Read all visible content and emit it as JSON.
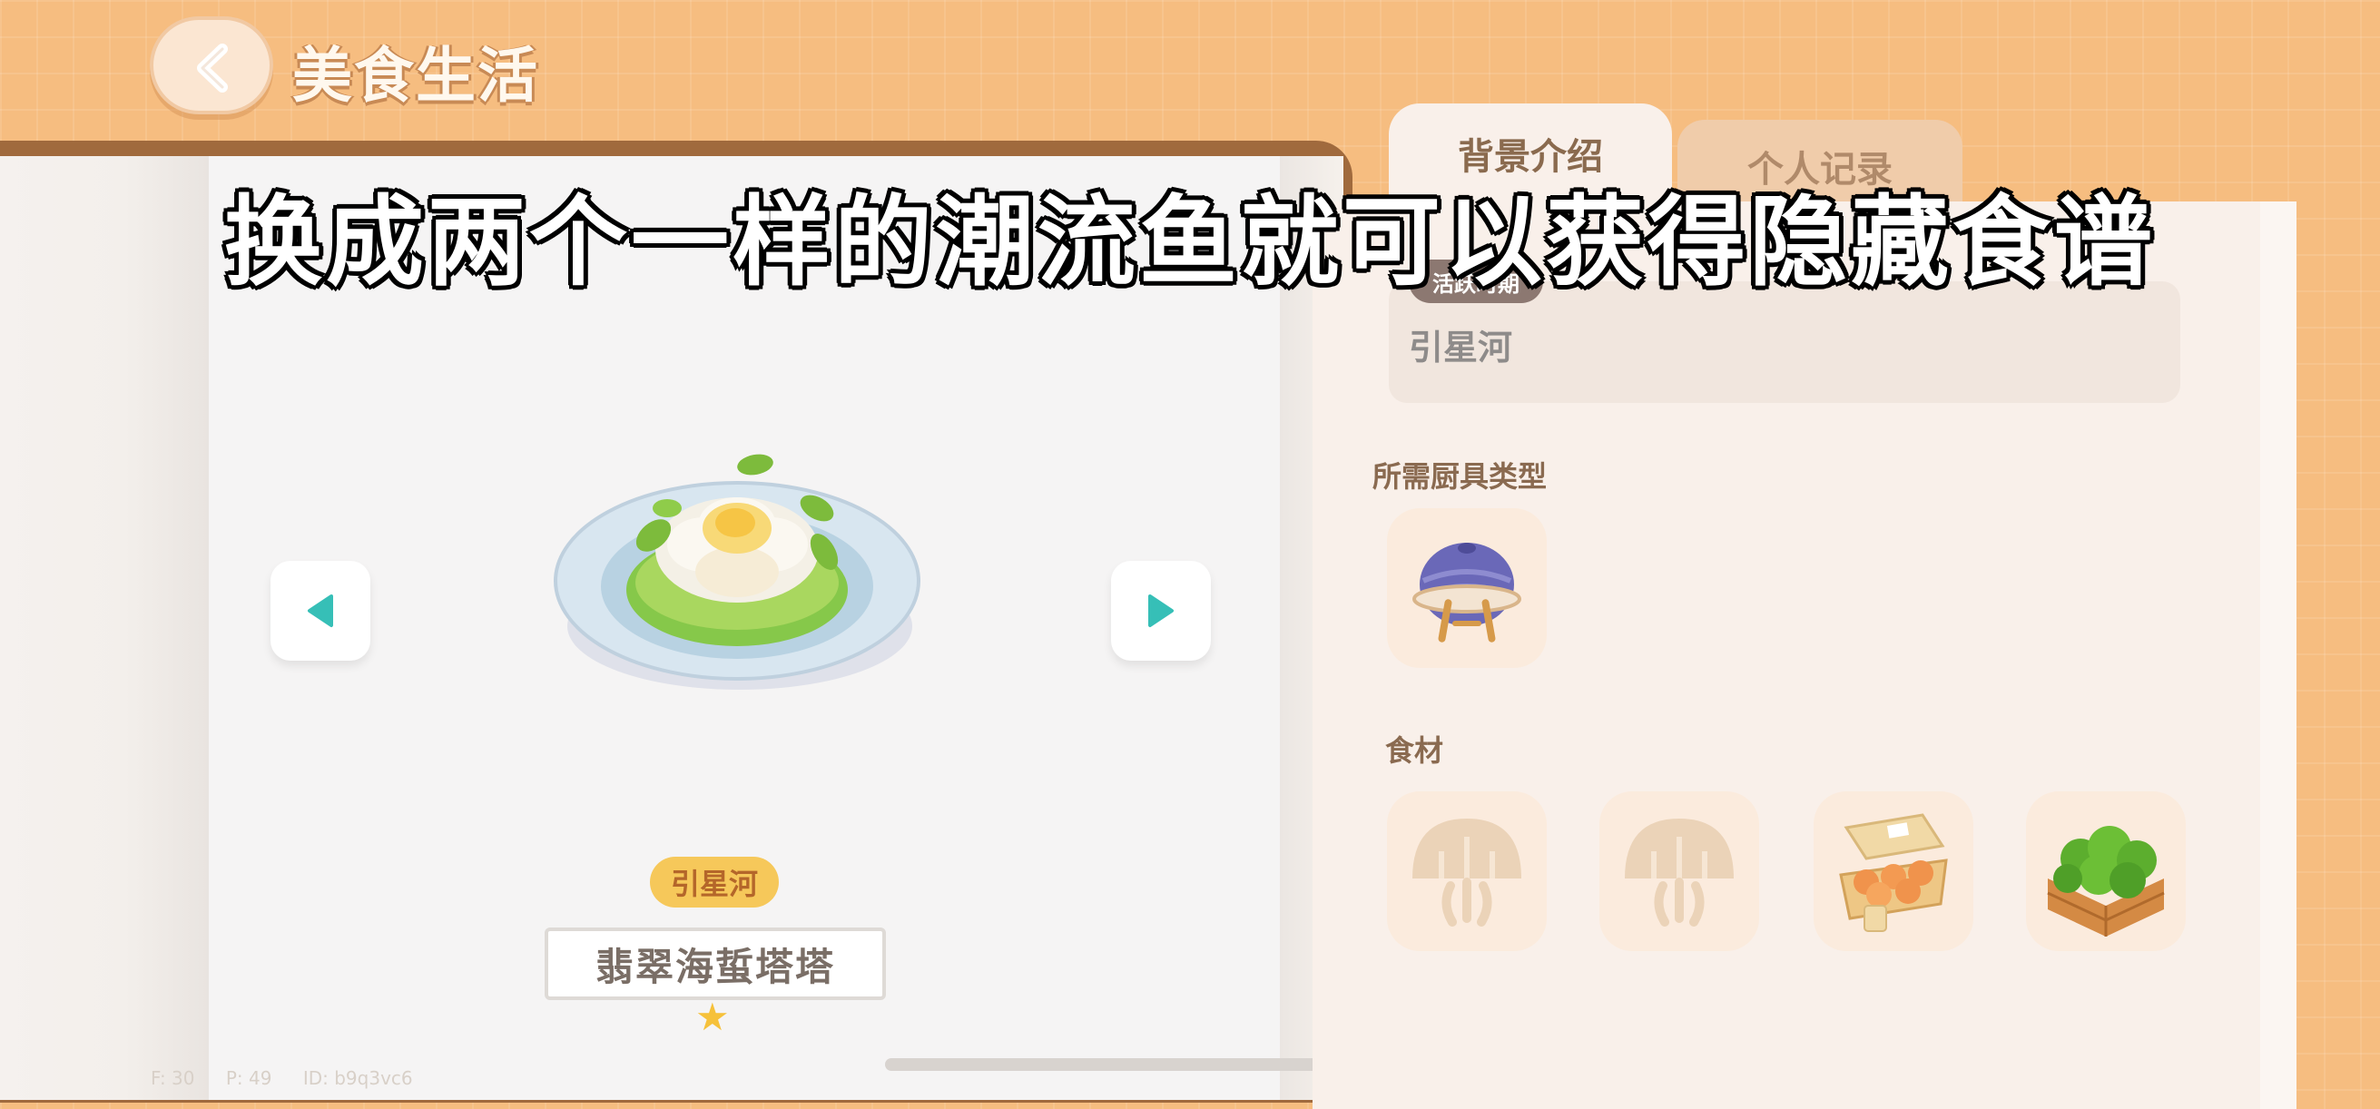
{
  "header": {
    "title": "美食生活"
  },
  "tabs": [
    {
      "label": "背景介绍",
      "active": true
    },
    {
      "label": "个人记录",
      "active": false
    }
  ],
  "recipe": {
    "region_tag": "引星河",
    "name": "翡翠海蜇塔塔",
    "stars": "★"
  },
  "info": {
    "period_badge": "活跃时期",
    "period_value": "引星河",
    "tool_section_label": "所需厨具类型",
    "tool_icon": "steamer-pot-icon",
    "ingredients_label": "食材",
    "ingredients": [
      {
        "icon": "jellyfish-icon",
        "locked": true
      },
      {
        "icon": "jellyfish-icon",
        "locked": true
      },
      {
        "icon": "egg-carton-icon",
        "locked": false
      },
      {
        "icon": "vegetable-crate-icon",
        "locked": false
      }
    ]
  },
  "subtitle": "换成两个一样的潮流鱼就可以获得隐藏食谱",
  "debug": {
    "fps": "F: 30",
    "ping": "P: 49",
    "id": "ID: b9q3vc6"
  },
  "colors": {
    "background": "#f6bd80",
    "teal_arrow": "#36bfb7",
    "region_tag": "#f6c85a",
    "star": "#f6c13a"
  }
}
